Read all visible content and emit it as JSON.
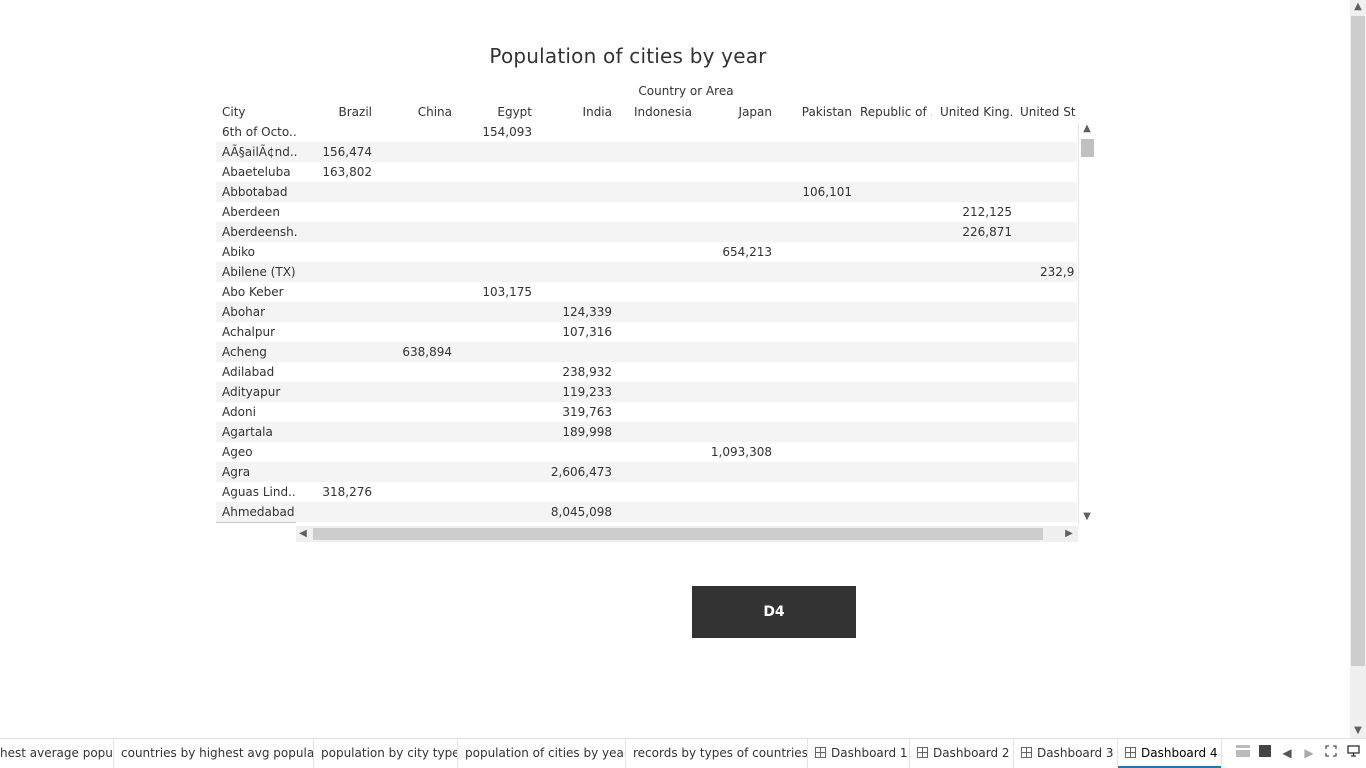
{
  "title": "Population of cities by year",
  "column_group": "Country or Area",
  "row_header": "City",
  "columns": [
    "Brazil",
    "China",
    "Egypt",
    "India",
    "Indonesia",
    "Japan",
    "Pakistan",
    "Republic of ..",
    "United King..",
    "United Sta.."
  ],
  "rows": [
    {
      "city": "6th of Octo..",
      "values": [
        "",
        "",
        "154,093",
        "",
        "",
        "",
        "",
        "",
        "",
        ""
      ]
    },
    {
      "city": "AÃ§ailÃ¢nd..",
      "values": [
        "156,474",
        "",
        "",
        "",
        "",
        "",
        "",
        "",
        "",
        ""
      ]
    },
    {
      "city": "Abaeteluba",
      "values": [
        "163,802",
        "",
        "",
        "",
        "",
        "",
        "",
        "",
        "",
        ""
      ]
    },
    {
      "city": "Abbotabad",
      "values": [
        "",
        "",
        "",
        "",
        "",
        "",
        "106,101",
        "",
        "",
        ""
      ]
    },
    {
      "city": "Aberdeen",
      "values": [
        "",
        "",
        "",
        "",
        "",
        "",
        "",
        "",
        "212,125",
        ""
      ]
    },
    {
      "city": "Aberdeensh..",
      "values": [
        "",
        "",
        "",
        "",
        "",
        "",
        "",
        "",
        "226,871",
        ""
      ]
    },
    {
      "city": "Abiko",
      "values": [
        "",
        "",
        "",
        "",
        "",
        "654,213",
        "",
        "",
        "",
        ""
      ]
    },
    {
      "city": "Abilene (TX)",
      "values": [
        "",
        "",
        "",
        "",
        "",
        "",
        "",
        "",
        "",
        "232,9"
      ]
    },
    {
      "city": "Abo Keber",
      "values": [
        "",
        "",
        "103,175",
        "",
        "",
        "",
        "",
        "",
        "",
        ""
      ]
    },
    {
      "city": "Abohar",
      "values": [
        "",
        "",
        "",
        "124,339",
        "",
        "",
        "",
        "",
        "",
        ""
      ]
    },
    {
      "city": "Achalpur",
      "values": [
        "",
        "",
        "",
        "107,316",
        "",
        "",
        "",
        "",
        "",
        ""
      ]
    },
    {
      "city": "Acheng",
      "values": [
        "",
        "638,894",
        "",
        "",
        "",
        "",
        "",
        "",
        "",
        ""
      ]
    },
    {
      "city": "Adilabad",
      "values": [
        "",
        "",
        "",
        "238,932",
        "",
        "",
        "",
        "",
        "",
        ""
      ]
    },
    {
      "city": "Adityapur",
      "values": [
        "",
        "",
        "",
        "119,233",
        "",
        "",
        "",
        "",
        "",
        ""
      ]
    },
    {
      "city": "Adoni",
      "values": [
        "",
        "",
        "",
        "319,763",
        "",
        "",
        "",
        "",
        "",
        ""
      ]
    },
    {
      "city": "Agartala",
      "values": [
        "",
        "",
        "",
        "189,998",
        "",
        "",
        "",
        "",
        "",
        ""
      ]
    },
    {
      "city": "Ageo",
      "values": [
        "",
        "",
        "",
        "",
        "",
        "1,093,308",
        "",
        "",
        "",
        ""
      ]
    },
    {
      "city": "Agra",
      "values": [
        "",
        "",
        "",
        "2,606,473",
        "",
        "",
        "",
        "",
        "",
        ""
      ]
    },
    {
      "city": "Aguas Lind..",
      "values": [
        "318,276",
        "",
        "",
        "",
        "",
        "",
        "",
        "",
        "",
        ""
      ]
    },
    {
      "city": "Ahmedabad",
      "values": [
        "",
        "",
        "",
        "8,045,098",
        "",
        "",
        "",
        "",
        "",
        ""
      ]
    }
  ],
  "button": {
    "label": "D4"
  },
  "tabs": [
    {
      "label": "hest average popu...",
      "icon": "",
      "active": false
    },
    {
      "label": "countries by highest avg populat...",
      "icon": "",
      "active": false
    },
    {
      "label": "population by city type",
      "icon": "",
      "active": false
    },
    {
      "label": "population of cities by year",
      "icon": "",
      "active": false
    },
    {
      "label": "records by types of countries",
      "icon": "",
      "active": false
    },
    {
      "label": "Dashboard 1",
      "icon": "dashboard-icon",
      "active": false
    },
    {
      "label": "Dashboard 2",
      "icon": "dashboard-icon",
      "active": false
    },
    {
      "label": "Dashboard 3",
      "icon": "dashboard-icon",
      "active": false
    },
    {
      "label": "Dashboard 4",
      "icon": "dashboard-icon",
      "active": true
    }
  ],
  "colors": {
    "button_bg": "#333333",
    "row_alt": "#f4f4f4",
    "active_tab_accent": "#1f77b4"
  }
}
